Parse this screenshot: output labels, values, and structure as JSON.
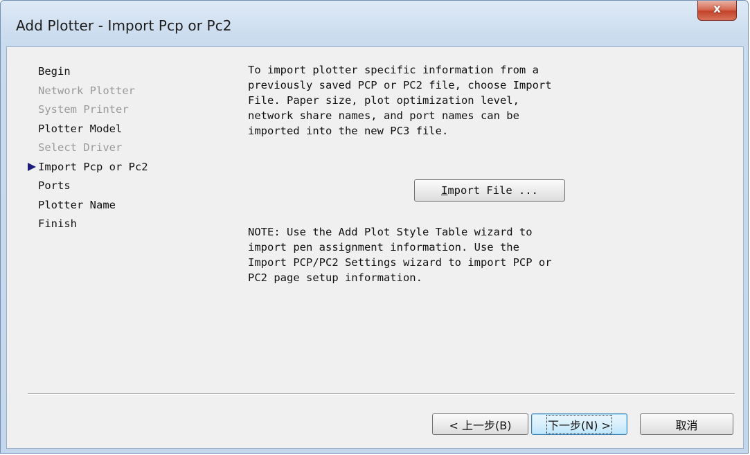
{
  "window": {
    "title": "Add Plotter - Import Pcp or Pc2",
    "close_glyph": "x",
    "close_icon": "close-icon"
  },
  "steps": [
    {
      "label": "Begin",
      "state": "enabled"
    },
    {
      "label": "Network Plotter",
      "state": "disabled"
    },
    {
      "label": "System Printer",
      "state": "disabled"
    },
    {
      "label": "Plotter Model",
      "state": "enabled"
    },
    {
      "label": "Select Driver",
      "state": "disabled"
    },
    {
      "label": "Import Pcp or Pc2",
      "state": "current"
    },
    {
      "label": "Ports",
      "state": "enabled"
    },
    {
      "label": "Plotter Name",
      "state": "enabled"
    },
    {
      "label": "Finish",
      "state": "enabled"
    }
  ],
  "current_step_icon": "current-step-arrow-icon",
  "content": {
    "description": "To import plotter specific information from a\npreviously saved PCP or PC2 file, choose Import\nFile. Paper size, plot optimization level,\nnetwork share names, and port names can be\nimported into the new PC3 file.",
    "import_button": {
      "mnemonic": "I",
      "rest": "mport File ..."
    },
    "note": "NOTE: Use the Add Plot Style Table wizard to\nimport pen assignment information. Use the\nImport PCP/PC2 Settings wizard to import PCP or\nPC2 page setup information."
  },
  "buttons": {
    "back": "< 上一步(B)",
    "next": "下一步(N) >",
    "cancel": "取消"
  },
  "colors": {
    "title_bar": "#cfdff0",
    "close_button": "#c4432b",
    "client_background": "#f0f0f0",
    "disabled_text": "#9a9a9a",
    "current_arrow": "#1e1e7a"
  }
}
